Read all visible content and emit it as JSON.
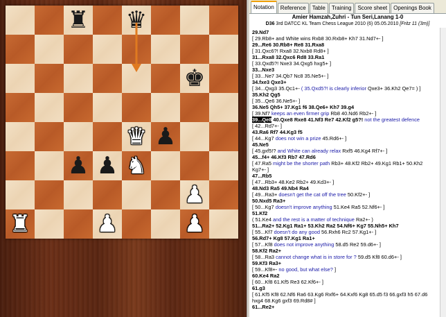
{
  "tabs": [
    "Notation",
    "Reference",
    "Table",
    "Training",
    "Score sheet",
    "Openings Book"
  ],
  "active_tab": "Notation",
  "header": {
    "players": "Amier Hamzah,Zuhri - Tun Seri,Lanang  1-0",
    "eco": "D36",
    "event": " 3rd DATCC KL Team Chess League 2010 (6) 05.05.2010 ",
    "engine": "[Fritz 11 (3m)]"
  },
  "board": {
    "squares": [
      [
        "",
        "",
        "bR",
        "",
        "bQ",
        "",
        "",
        ""
      ],
      [
        "",
        "",
        "",
        "",
        "",
        "",
        "",
        ""
      ],
      [
        "",
        "",
        "",
        "",
        "",
        "",
        "bK",
        ""
      ],
      [
        "",
        "",
        "",
        "",
        "",
        "",
        "",
        ""
      ],
      [
        "",
        "",
        "",
        "",
        "wQ",
        "bP",
        "",
        ""
      ],
      [
        "",
        "",
        "bP",
        "bP",
        "wN",
        "",
        "",
        ""
      ],
      [
        "",
        "",
        "",
        "",
        "",
        "",
        "",
        ""
      ],
      [
        "",
        "",
        "",
        "wP",
        "",
        "",
        "wP",
        ""
      ]
    ],
    "squares_bottom": [
      [
        "",
        "",
        "",
        "",
        "",
        "",
        "",
        ""
      ],
      [
        "",
        "",
        "",
        "",
        "",
        "",
        "",
        ""
      ],
      [
        "",
        "",
        "",
        "",
        "",
        "",
        "",
        ""
      ],
      [
        "",
        "",
        "",
        "",
        "",
        "",
        "",
        ""
      ],
      [
        "",
        "",
        "",
        "",
        "",
        "",
        "",
        ""
      ],
      [
        "",
        "",
        "",
        "",
        "",
        "",
        "",
        ""
      ],
      [
        "",
        "",
        "",
        "",
        "",
        "",
        "wP",
        ""
      ],
      [
        "wR",
        "",
        "",
        "",
        "",
        "",
        "wK",
        ""
      ]
    ]
  },
  "moves": [
    [
      {
        "t": "mv",
        "s": "29.Nd7"
      }
    ],
    [
      {
        "t": "var",
        "s": "[ "
      },
      {
        "t": "var",
        "s": "29.Rb8+ and White wins  Rxb8 30.Rxb8+ Kh7 31.Nd7+-"
      },
      {
        "t": "var",
        "s": " ]"
      }
    ],
    [
      {
        "t": "mv",
        "s": "29...Re6 30.Rb8+ Re8 31.Rxa8"
      }
    ],
    [
      {
        "t": "var",
        "s": "[ 31.Qxc6?! Rxa8 32.Nxb8 Rd8+ ]"
      }
    ],
    [
      {
        "t": "mv",
        "s": "31...Rxa8 32.Qxc6 Rd8 33.Ra1"
      }
    ],
    [
      {
        "t": "var",
        "s": "[ 33.Qxd5?! Nxe3 34.Qxg5 hxg5+ ]"
      }
    ],
    [
      {
        "t": "mv",
        "s": "33...Nxe3"
      }
    ],
    [
      {
        "t": "var",
        "s": "[ 33...Ne7 34.Qb7 Nc8 35.Ne5+- ]"
      }
    ],
    [
      {
        "t": "mv",
        "s": "34.fxe3 Qxe3+"
      }
    ],
    [
      {
        "t": "var",
        "s": "[ 34...Qxg3 35.Qc1+- "
      },
      {
        "t": "cm",
        "s": "( 35.Qxd5?! is clearly inferior "
      },
      {
        "t": "var",
        "s": "Qxe3+ 36.Kh2 Qe7= ) ]"
      }
    ],
    [
      {
        "t": "mv",
        "s": "35.Kh2 Qg5"
      }
    ],
    [
      {
        "t": "var",
        "s": "[ 35...Qe6 36.Ne5+- ]"
      }
    ],
    [
      {
        "t": "mv",
        "s": "36.Ne5 Qh5+ 37.Kg1 f6 38.Qe6+ Kh7 39.g4"
      }
    ],
    [
      {
        "t": "var",
        "s": "[ 39.Nf7 "
      },
      {
        "t": "cm",
        "s": "keeps an even firmer grip "
      },
      {
        "t": "var",
        "s": "Rb8 40.Nd6 Rb2+- ]"
      }
    ],
    [
      {
        "t": "cur",
        "s": "39...Qe8"
      },
      {
        "t": "mv",
        "s": " 40.Qxe8 Rxe8 41.Nf3 Re7 42.Kf2 g5?! "
      },
      {
        "t": "cm",
        "s": "not the greatest defence"
      }
    ],
    [
      {
        "t": "var",
        "s": "[ 42...Rd7+- ]"
      }
    ],
    [
      {
        "t": "mv",
        "s": "43.Ra6 Rf7 44.Kg3 f5"
      }
    ],
    [
      {
        "t": "var",
        "s": "[ 44...Kg7 "
      },
      {
        "t": "cm",
        "s": "does not win a prize "
      },
      {
        "t": "var",
        "s": "45.Rd6+- ]"
      }
    ],
    [
      {
        "t": "mv",
        "s": "45.Ne5"
      }
    ],
    [
      {
        "t": "var",
        "s": "[ 45.gxf5!? "
      },
      {
        "t": "cm",
        "s": "and White can already relax "
      },
      {
        "t": "var",
        "s": "Rxf5 46.Kg4 Rf7+- ]"
      }
    ],
    [
      {
        "t": "mv",
        "s": "45...f4+ 46.Kf3 Rb7 47.Rd6"
      }
    ],
    [
      {
        "t": "var",
        "s": "[ 47.Ra5 "
      },
      {
        "t": "cm",
        "s": "might be the shorter path "
      },
      {
        "t": "var",
        "s": "Rb3+ 48.Kf2 Rb2+ 49.Kg1 Rb1+ 50.Kh2"
      }
    ],
    [
      {
        "t": "var",
        "s": "Kg7+- ]"
      }
    ],
    [
      {
        "t": "mv",
        "s": "47...Rb5"
      }
    ],
    [
      {
        "t": "var",
        "s": "[ 47...Rb3+ 48.Ke2 Rb2+ 49.Kd3+- ]"
      }
    ],
    [
      {
        "t": "mv",
        "s": "48.Nd3 Ra5 49.Nb4 Ra4"
      }
    ],
    [
      {
        "t": "var",
        "s": "[ 49...Ra3+ "
      },
      {
        "t": "cm",
        "s": "doesn't get the cat off the tree "
      },
      {
        "t": "var",
        "s": "50.Kf2+- ]"
      }
    ],
    [
      {
        "t": "mv",
        "s": "50.Nxd5 Ra3+"
      }
    ],
    [
      {
        "t": "var",
        "s": "[ 50...Kg7 "
      },
      {
        "t": "cm",
        "s": "doesn't improve anything "
      },
      {
        "t": "var",
        "s": "51.Ke4 Ra5 52.Nf6+- ]"
      }
    ],
    [
      {
        "t": "mv",
        "s": "51.Kf2"
      }
    ],
    [
      {
        "t": "var",
        "s": "( 51.Ke4 "
      },
      {
        "t": "cm",
        "s": "and the rest is a matter of technique "
      },
      {
        "t": "var",
        "s": "Ra2+- )"
      }
    ],
    [
      {
        "t": "mv",
        "s": "51...Ra2+ 52.Kg1 Ra1+ 53.Kh2 Ra2 54.Nf6+ Kg7 55.Nh5+ Kh7"
      }
    ],
    [
      {
        "t": "var",
        "s": "[ 55...Kf7 "
      },
      {
        "t": "cm",
        "s": "doesn't do any good "
      },
      {
        "t": "var",
        "s": "56.Rxh6 Rc2 57.Kg1+- ]"
      }
    ],
    [
      {
        "t": "mv",
        "s": "56.Rd7+ Kg8 57.Kg1 Ra1+"
      }
    ],
    [
      {
        "t": "var",
        "s": "[ 57...Kf8 "
      },
      {
        "t": "cm",
        "s": "does not improve anything "
      },
      {
        "t": "var",
        "s": "58.d5 Re2 59.d6+- ]"
      }
    ],
    [
      {
        "t": "mv",
        "s": "58.Kf2 Ra2+"
      }
    ],
    [
      {
        "t": "var",
        "s": "[ 58...Ra3 "
      },
      {
        "t": "cm",
        "s": "cannot change what is in store for ? "
      },
      {
        "t": "var",
        "s": "59.d5 Kf8 60.d6+- ]"
      }
    ],
    [
      {
        "t": "mv",
        "s": "59.Kf3 Ra3+"
      }
    ],
    [
      {
        "t": "var",
        "s": "[ 59...Kf8+- "
      },
      {
        "t": "cm",
        "s": "no good, but what else? "
      },
      {
        "t": "var",
        "s": "]"
      }
    ],
    [
      {
        "t": "mv",
        "s": "60.Ke4 Ra2"
      }
    ],
    [
      {
        "t": "var",
        "s": "[ 60...Kf8 61.Kf5 Re3 62.Kf6+- ]"
      }
    ],
    [
      {
        "t": "mv",
        "s": "61.g3"
      }
    ],
    [
      {
        "t": "var",
        "s": "[ 61.Kf5 Kf8 62.Nf6 Ra6 63.Kg6 Rxf6+ 64.Kxf6 Kg8 65.d5 f3 66.gxf3 h5 67.d6"
      }
    ],
    [
      {
        "t": "var",
        "s": "hxg4 68.Kg6 gxf3 69.Rd8# ]"
      }
    ],
    [
      {
        "t": "mv",
        "s": "61...Re2+"
      }
    ]
  ]
}
